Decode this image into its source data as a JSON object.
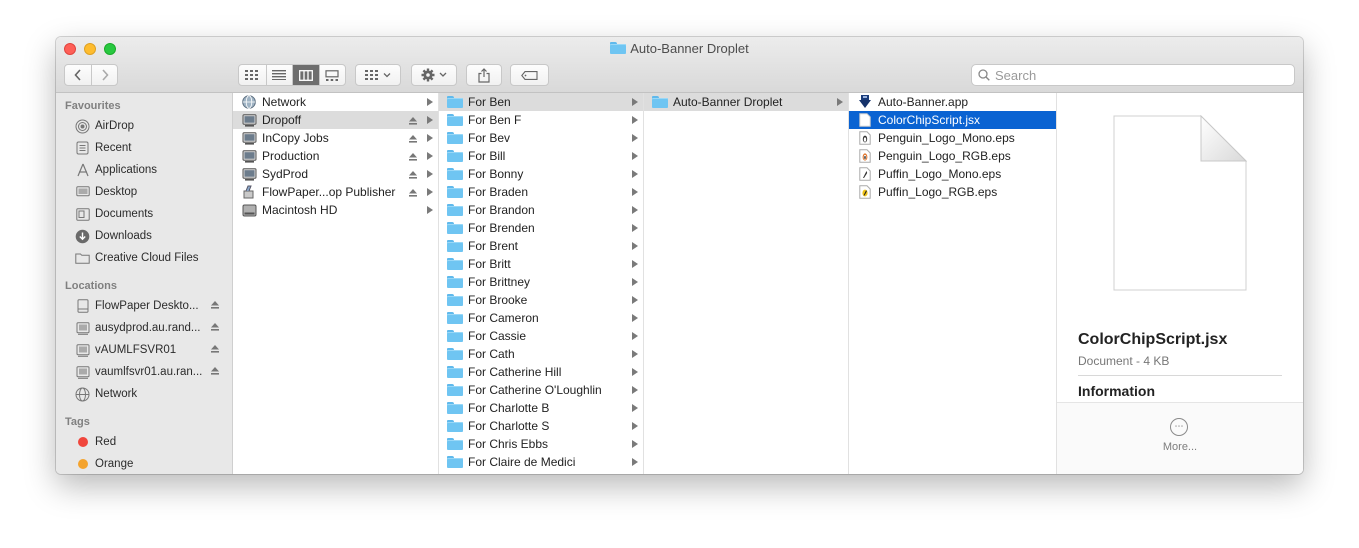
{
  "window": {
    "title": "Auto-Banner Droplet"
  },
  "toolbar": {
    "search_placeholder": "Search"
  },
  "sidebar": {
    "favourites_header": "Favourites",
    "favourites": [
      {
        "label": "AirDrop",
        "icon": "airdrop-icon"
      },
      {
        "label": "Recent",
        "icon": "recent-icon"
      },
      {
        "label": "Applications",
        "icon": "applications-icon"
      },
      {
        "label": "Desktop",
        "icon": "desktop-icon"
      },
      {
        "label": "Documents",
        "icon": "documents-icon"
      },
      {
        "label": "Downloads",
        "icon": "downloads-icon"
      },
      {
        "label": "Creative Cloud Files",
        "icon": "folder-icon"
      }
    ],
    "locations_header": "Locations",
    "locations": [
      {
        "label": "FlowPaper Deskto...",
        "icon": "disk-icon",
        "eject": true
      },
      {
        "label": "ausydprod.au.rand...",
        "icon": "server-icon",
        "eject": true
      },
      {
        "label": "vAUMLFSVR01",
        "icon": "server-icon",
        "eject": true
      },
      {
        "label": "vaumlfsvr01.au.ran...",
        "icon": "server-icon",
        "eject": true
      },
      {
        "label": "Network",
        "icon": "network-icon",
        "eject": false
      }
    ],
    "tags_header": "Tags",
    "tags": [
      {
        "label": "Red",
        "color": "#f0463c"
      },
      {
        "label": "Orange",
        "color": "#f4a32d"
      }
    ]
  },
  "columns": {
    "col1": [
      {
        "label": "Network",
        "icon": "network-icon",
        "eject": false
      },
      {
        "label": "Dropoff",
        "icon": "server-icon",
        "eject": true,
        "selected": true
      },
      {
        "label": "InCopy Jobs",
        "icon": "server-icon",
        "eject": true
      },
      {
        "label": "Production",
        "icon": "server-icon",
        "eject": true
      },
      {
        "label": "SydProd",
        "icon": "server-icon",
        "eject": true
      },
      {
        "label": "FlowPaper...op Publisher",
        "icon": "installer-icon",
        "eject": true
      },
      {
        "label": "Macintosh HD",
        "icon": "harddisk-icon",
        "eject": false
      }
    ],
    "col2": [
      "For Ben",
      "For Ben F",
      "For Bev",
      "For Bill",
      "For Bonny",
      "For Braden",
      "For Brandon",
      "For Brenden",
      "For Brent",
      "For Britt",
      "For Brittney",
      "For Brooke",
      "For Cameron",
      "For Cassie",
      "For Cath",
      "For Catherine Hill",
      "For Catherine O'Loughlin",
      "For Charlotte B",
      "For Charlotte S",
      "For Chris Ebbs",
      "For Claire de Medici"
    ],
    "col3": [
      "Auto-Banner Droplet"
    ],
    "col4": [
      {
        "label": "Auto-Banner.app",
        "icon": "droplet-app-icon"
      },
      {
        "label": "ColorChipScript.jsx",
        "icon": "document-icon",
        "selected": true
      },
      {
        "label": "Penguin_Logo_Mono.eps",
        "icon": "eps-icon"
      },
      {
        "label": "Penguin_Logo_RGB.eps",
        "icon": "eps-icon"
      },
      {
        "label": "Puffin_Logo_Mono.eps",
        "icon": "eps-icon"
      },
      {
        "label": "Puffin_Logo_RGB.eps",
        "icon": "eps-icon"
      }
    ]
  },
  "preview": {
    "name": "ColorChipScript.jsx",
    "kind": "Document - 4 KB",
    "info_header": "Information",
    "more_label": "More..."
  },
  "colors": {
    "selection_blue": "#0a63d2",
    "selection_grey": "#dcdcdc",
    "folder_blue": "#6fc5f2"
  }
}
